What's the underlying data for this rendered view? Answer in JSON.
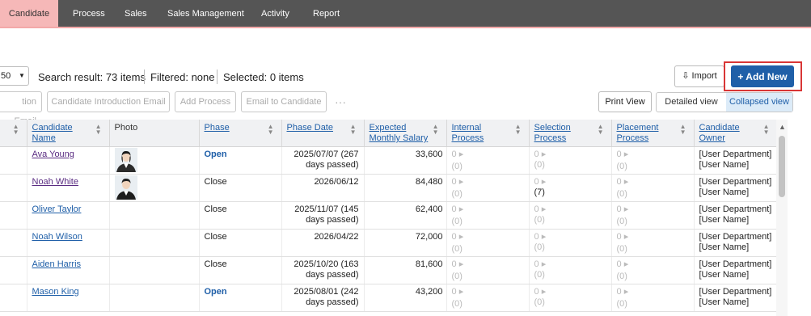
{
  "nav": {
    "items": [
      "Candidate",
      "Process",
      "Sales",
      "Sales Management",
      "Activity",
      "Report"
    ],
    "active": "Candidate"
  },
  "toolbar": {
    "per_page": "50",
    "search_result": "Search result: 73 items",
    "filtered": "Filtered: none",
    "selected": "Selected:  0 items",
    "import_label": "Import",
    "add_new_label": "+ Add New",
    "actions": [
      "tion Email",
      "Candidate Introduction Email",
      "Add Process",
      "Email to Candidate"
    ],
    "more": "···",
    "print_view": "Print View",
    "detailed_view": "Detailed view",
    "collapsed_view": "Collapsed view"
  },
  "table": {
    "headers": [
      "Candidate Name",
      "Photo",
      "Phase",
      "Phase Date",
      "Expected Monthly Salary",
      "Internal Process",
      "Selection Process",
      "Placement Process",
      "Candidate Owner"
    ],
    "rows": [
      {
        "name": "Ava Young",
        "visited": true,
        "photo": "female",
        "phase": "Open",
        "date": "2025/07/07 (267 days passed)",
        "salary": "33,600",
        "internal": [
          "0",
          "(0)"
        ],
        "selection": [
          "0",
          "(0)"
        ],
        "placement": [
          "0",
          "(0)"
        ],
        "owner": [
          "[User Department]",
          "[User Name]"
        ]
      },
      {
        "name": "Noah White",
        "visited": true,
        "photo": "male",
        "phase": "Close",
        "date": "2026/06/12",
        "salary": "84,480",
        "internal": [
          "0",
          "(0)"
        ],
        "selection": [
          "0",
          "(7)"
        ],
        "placement": [
          "0",
          "(0)"
        ],
        "owner": [
          "[User Department]",
          "[User Name]"
        ]
      },
      {
        "name": "Oliver Taylor",
        "visited": false,
        "photo": "",
        "phase": "Close",
        "date": "2025/11/07 (145 days passed)",
        "salary": "62,400",
        "internal": [
          "0",
          "(0)"
        ],
        "selection": [
          "0",
          "(0)"
        ],
        "placement": [
          "0",
          "(0)"
        ],
        "owner": [
          "[User Department]",
          "[User Name]"
        ]
      },
      {
        "name": "Noah Wilson",
        "visited": false,
        "photo": "",
        "phase": "Close",
        "date": "2026/04/22",
        "salary": "72,000",
        "internal": [
          "0",
          "(0)"
        ],
        "selection": [
          "0",
          "(0)"
        ],
        "placement": [
          "0",
          "(0)"
        ],
        "owner": [
          "[User Department]",
          "[User Name]"
        ]
      },
      {
        "name": "Aiden Harris",
        "visited": false,
        "photo": "",
        "phase": "Close",
        "date": "2025/10/20 (163 days passed)",
        "salary": "81,600",
        "internal": [
          "0",
          "(0)"
        ],
        "selection": [
          "0",
          "(0)"
        ],
        "placement": [
          "0",
          "(0)"
        ],
        "owner": [
          "[User Department]",
          "[User Name]"
        ]
      },
      {
        "name": "Mason King",
        "visited": false,
        "photo": "",
        "phase": "Open",
        "date": "2025/08/01 (242 days passed)",
        "salary": "43,200",
        "internal": [
          "0",
          "(0)"
        ],
        "selection": [
          "0",
          "(0)"
        ],
        "placement": [
          "0",
          "(0)"
        ],
        "owner": [
          "[User Department]",
          "[User Name]"
        ]
      }
    ]
  },
  "colors": {
    "nav_bg": "#555555",
    "nav_active": "#f6b8b8",
    "primary": "#1f5fa8",
    "highlight": "#d93636"
  }
}
